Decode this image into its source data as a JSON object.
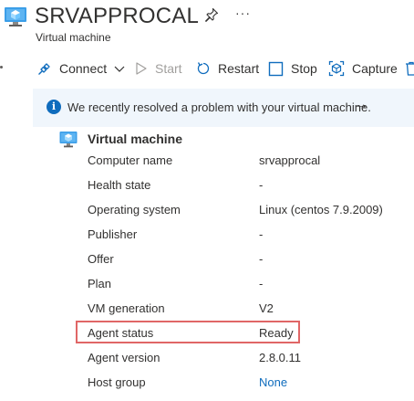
{
  "header": {
    "title": "SRVAPPROCAL",
    "subtitle": "Virtual machine",
    "more_label": "···"
  },
  "toolbar": {
    "connect": "Connect",
    "start": "Start",
    "restart": "Restart",
    "stop": "Stop",
    "capture": "Capture"
  },
  "banner": {
    "message": "We recently resolved a problem with your virtual machine.",
    "arrow": "→"
  },
  "section": {
    "title": "Virtual machine",
    "rows": [
      {
        "key": "Computer name",
        "value": "srvapprocal"
      },
      {
        "key": "Health state",
        "value": "-"
      },
      {
        "key": "Operating system",
        "value": "Linux (centos 7.9.2009)"
      },
      {
        "key": "Publisher",
        "value": "-"
      },
      {
        "key": "Offer",
        "value": "-"
      },
      {
        "key": "Plan",
        "value": "-"
      },
      {
        "key": "VM generation",
        "value": "V2"
      },
      {
        "key": "Agent status",
        "value": "Ready"
      },
      {
        "key": "Agent version",
        "value": "2.8.0.11"
      },
      {
        "key": "Host group",
        "value": "None"
      }
    ]
  },
  "colors": {
    "accent": "#0f6cbd",
    "highlight_border": "#e06666",
    "banner_bg": "#f0f6fc"
  }
}
